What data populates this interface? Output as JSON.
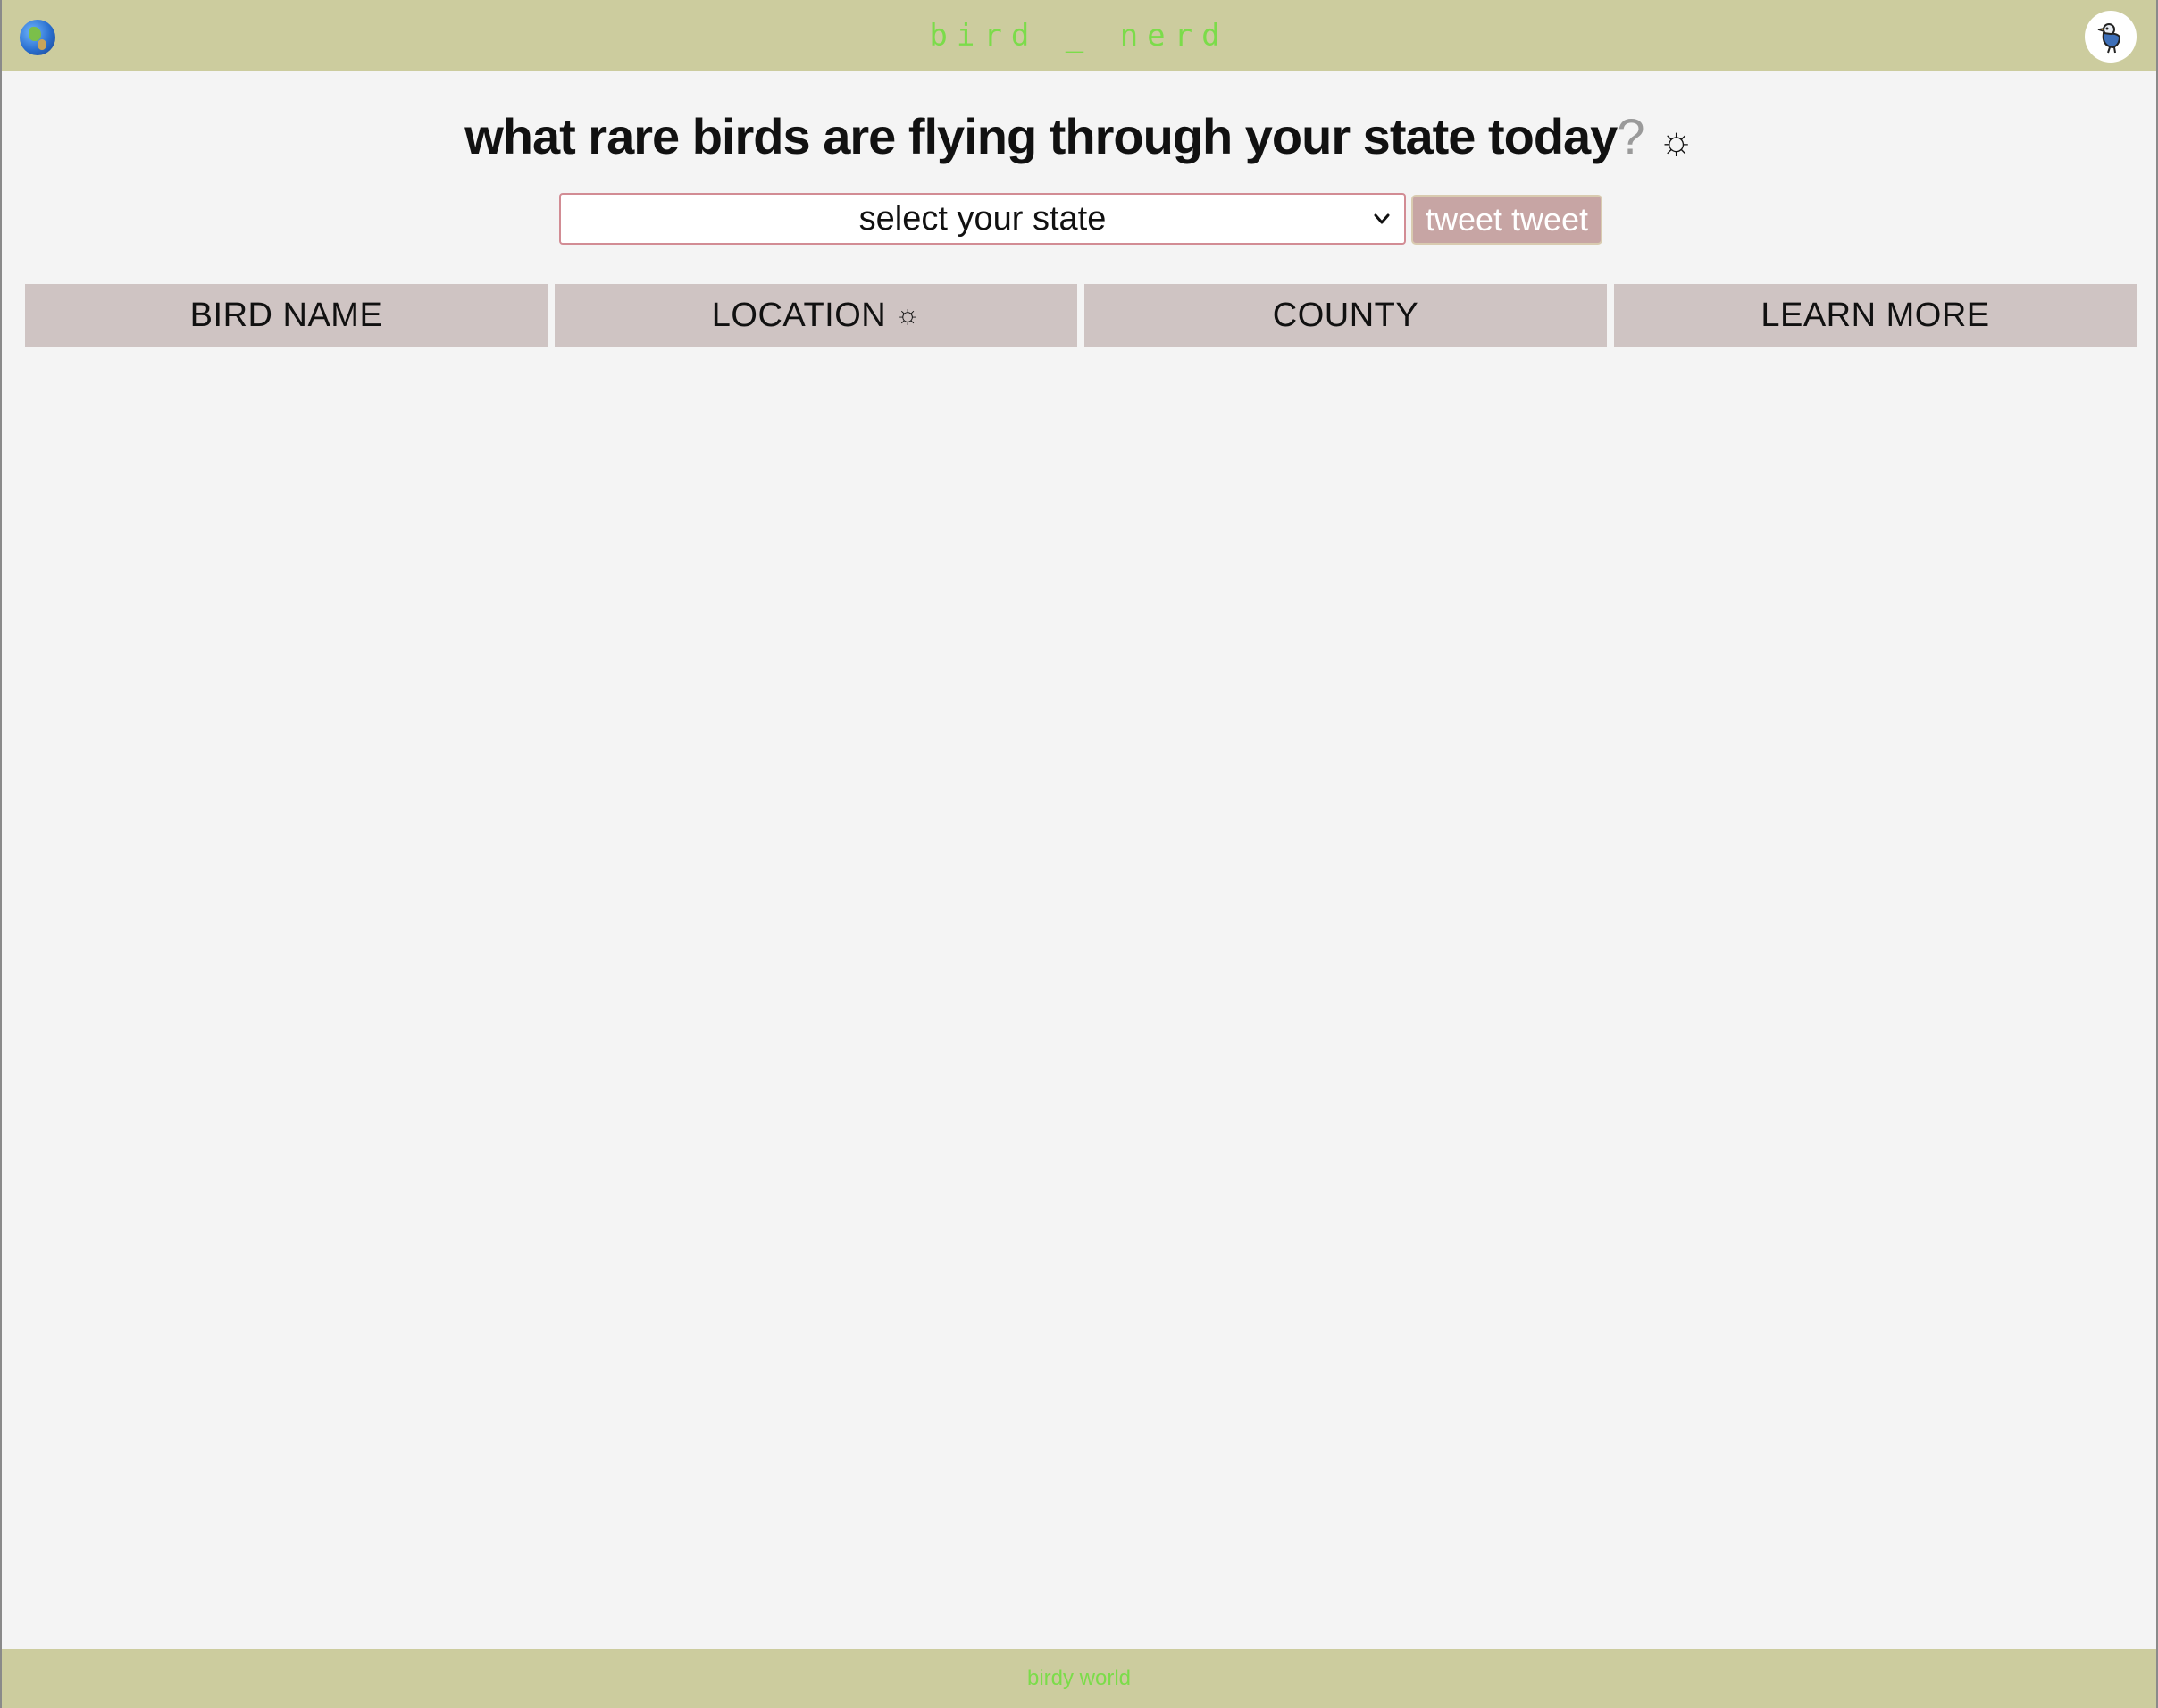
{
  "header": {
    "brand": "bird _ nerd",
    "globe_icon": "globe-icon",
    "avatar_icon": "bird-icon"
  },
  "main": {
    "headline_text": "what rare birds are flying through your state today",
    "headline_qmark": "?",
    "headline_icon": "☼",
    "state_select": {
      "selected": "select your state"
    },
    "submit_label": "tweet tweet"
  },
  "table": {
    "columns": [
      "BIRD NAME",
      "LOCATION",
      "COUNTY",
      "LEARN MORE"
    ],
    "location_icon": "☼",
    "rows": []
  },
  "footer": {
    "text": "birdy world"
  },
  "colors": {
    "bar": "#cccc9e",
    "brand_green": "#7bdc4a",
    "header_cell": "#cfc4c3",
    "button": "#c7a5a4",
    "select_border": "#d28c94"
  }
}
